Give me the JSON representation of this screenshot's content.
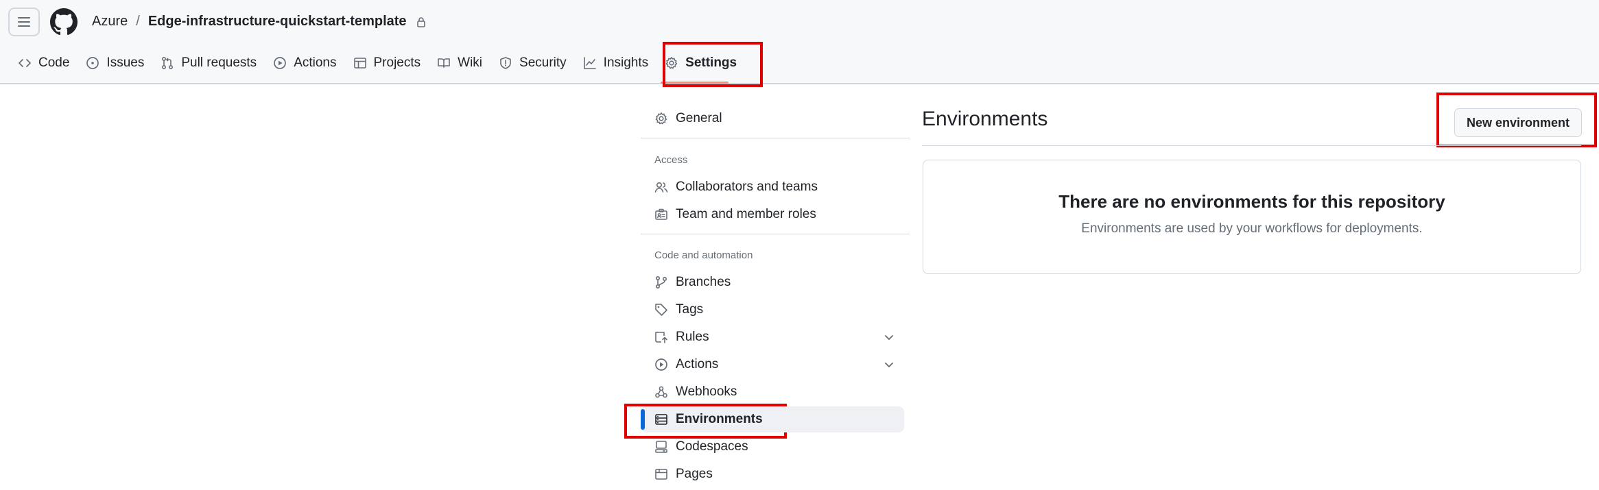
{
  "breadcrumb": {
    "owner": "Azure",
    "separator": "/",
    "repo": "Edge-infrastructure-quickstart-template"
  },
  "tabs": [
    {
      "label": "Code",
      "icon": "code-icon"
    },
    {
      "label": "Issues",
      "icon": "issue-opened-icon"
    },
    {
      "label": "Pull requests",
      "icon": "git-pull-request-icon"
    },
    {
      "label": "Actions",
      "icon": "play-icon"
    },
    {
      "label": "Projects",
      "icon": "table-icon"
    },
    {
      "label": "Wiki",
      "icon": "book-icon"
    },
    {
      "label": "Security",
      "icon": "shield-icon"
    },
    {
      "label": "Insights",
      "icon": "graph-icon"
    },
    {
      "label": "Settings",
      "icon": "gear-icon",
      "active": true
    }
  ],
  "sidebar": {
    "general": "General",
    "access_label": "Access",
    "access_items": [
      "Collaborators and teams",
      "Team and member roles"
    ],
    "code_label": "Code and automation",
    "code_items": [
      "Branches",
      "Tags",
      "Rules",
      "Actions",
      "Webhooks",
      "Environments",
      "Codespaces",
      "Pages"
    ],
    "active_item": "Environments"
  },
  "main": {
    "title": "Environments",
    "new_button": "New environment",
    "empty_title": "There are no environments for this repository",
    "empty_desc": "Environments are used by your workflows for deployments."
  },
  "colors": {
    "accent": "#0969da",
    "highlight": "#e00000",
    "tab_underline": "#fd8c73"
  }
}
